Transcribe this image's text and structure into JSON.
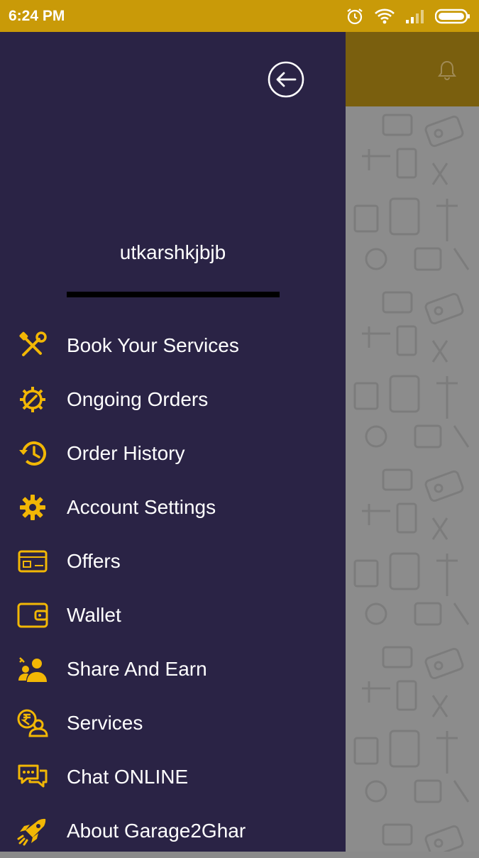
{
  "status_bar": {
    "time": "6:24 PM",
    "icons": [
      "alarm-icon",
      "wifi-icon",
      "signal-icon",
      "battery-icon"
    ]
  },
  "colors": {
    "accent": "#c99a08",
    "drawer_background": "#2a2345",
    "icon_color": "#f2b705",
    "text_color": "#ffffff"
  },
  "drawer": {
    "username": "utkarshkjbjb",
    "back_icon": "back-arrow-icon",
    "items": [
      {
        "label": "Book Your Services",
        "icon": "tools-icon"
      },
      {
        "label": "Ongoing Orders",
        "icon": "gear-wrench-icon"
      },
      {
        "label": "Order History",
        "icon": "history-icon"
      },
      {
        "label": "Account Settings",
        "icon": "settings-icon"
      },
      {
        "label": "Offers",
        "icon": "offer-card-icon"
      },
      {
        "label": "Wallet",
        "icon": "wallet-icon"
      },
      {
        "label": "Share And Earn",
        "icon": "share-earn-icon"
      },
      {
        "label": "Services",
        "icon": "rupee-person-icon"
      },
      {
        "label": "Chat ONLINE",
        "icon": "chat-icon"
      },
      {
        "label": "About Garage2Ghar",
        "icon": "rocket-icon"
      }
    ]
  },
  "background_app": {
    "toolbar_icon": "bell-icon"
  }
}
